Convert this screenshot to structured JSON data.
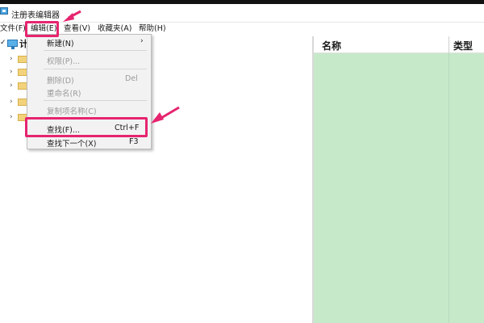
{
  "window": {
    "title": "注册表编辑器"
  },
  "menubar": {
    "file": "文件(F)",
    "edit": "编辑(E)",
    "view": "查看(V)",
    "favorites": "收藏夹(A)",
    "help": "帮助(H)"
  },
  "tree": {
    "root_label": "计",
    "root_arrow": "✓",
    "child_arrow": "›"
  },
  "columns": {
    "name": "名称",
    "type": "类型"
  },
  "edit_menu": {
    "new_label": "新建(N)",
    "new_arrow": "›",
    "permissions_label": "权限(P)...",
    "delete_label": "删除(D)",
    "delete_shortcut": "Del",
    "rename_label": "重命名(R)",
    "copy_key_name_label": "复制项名称(C)",
    "find_label": "查找(F)...",
    "find_shortcut": "Ctrl+F",
    "find_next_label": "查找下一个(X)",
    "find_next_shortcut": "F3"
  },
  "colors": {
    "highlight": "#e6246f",
    "values_pane": "#c6e9ca",
    "menu_background": "#f2f2f2"
  }
}
